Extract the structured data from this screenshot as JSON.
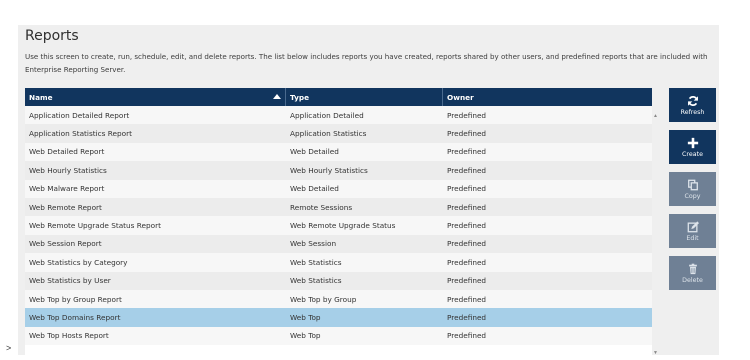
{
  "page": {
    "title": "Reports",
    "description": "Use this screen to create, run, schedule, edit, and delete reports. The list below includes reports you have created, reports shared by other users, and predefined reports that are included with Enterprise Reporting Server."
  },
  "table": {
    "columns": [
      "Name",
      "Type",
      "Owner"
    ],
    "rows": [
      {
        "name": "Application Detailed Report",
        "type": "Application Detailed",
        "owner": "Predefined"
      },
      {
        "name": "Application Statistics Report",
        "type": "Application Statistics",
        "owner": "Predefined"
      },
      {
        "name": "Web Detailed Report",
        "type": "Web Detailed",
        "owner": "Predefined"
      },
      {
        "name": "Web Hourly Statistics",
        "type": "Web Hourly Statistics",
        "owner": "Predefined"
      },
      {
        "name": "Web Malware Report",
        "type": "Web Detailed",
        "owner": "Predefined"
      },
      {
        "name": "Web Remote Report",
        "type": "Remote Sessions",
        "owner": "Predefined"
      },
      {
        "name": "Web Remote Upgrade Status Report",
        "type": "Web Remote Upgrade Status",
        "owner": "Predefined"
      },
      {
        "name": "Web Session Report",
        "type": "Web Session",
        "owner": "Predefined"
      },
      {
        "name": "Web Statistics by Category",
        "type": "Web Statistics",
        "owner": "Predefined"
      },
      {
        "name": "Web Statistics by User",
        "type": "Web Statistics",
        "owner": "Predefined"
      },
      {
        "name": "Web Top by Group Report",
        "type": "Web Top by Group",
        "owner": "Predefined"
      },
      {
        "name": "Web Top Domains Report",
        "type": "Web Top",
        "owner": "Predefined"
      },
      {
        "name": "Web Top Hosts Report",
        "type": "Web Top",
        "owner": "Predefined"
      }
    ],
    "selected_row": "Web Top Domains Report",
    "selected_color": "#a6cfe8",
    "header_color": "#11355e"
  },
  "buttons": {
    "refresh": "Refresh",
    "create": "Create",
    "copy": "Copy",
    "edit": "Edit",
    "delete": "Delete"
  },
  "icons": [
    "refresh-icon",
    "plus-icon",
    "copy-icon",
    "edit-icon",
    "trash-icon"
  ],
  "caret": ">"
}
